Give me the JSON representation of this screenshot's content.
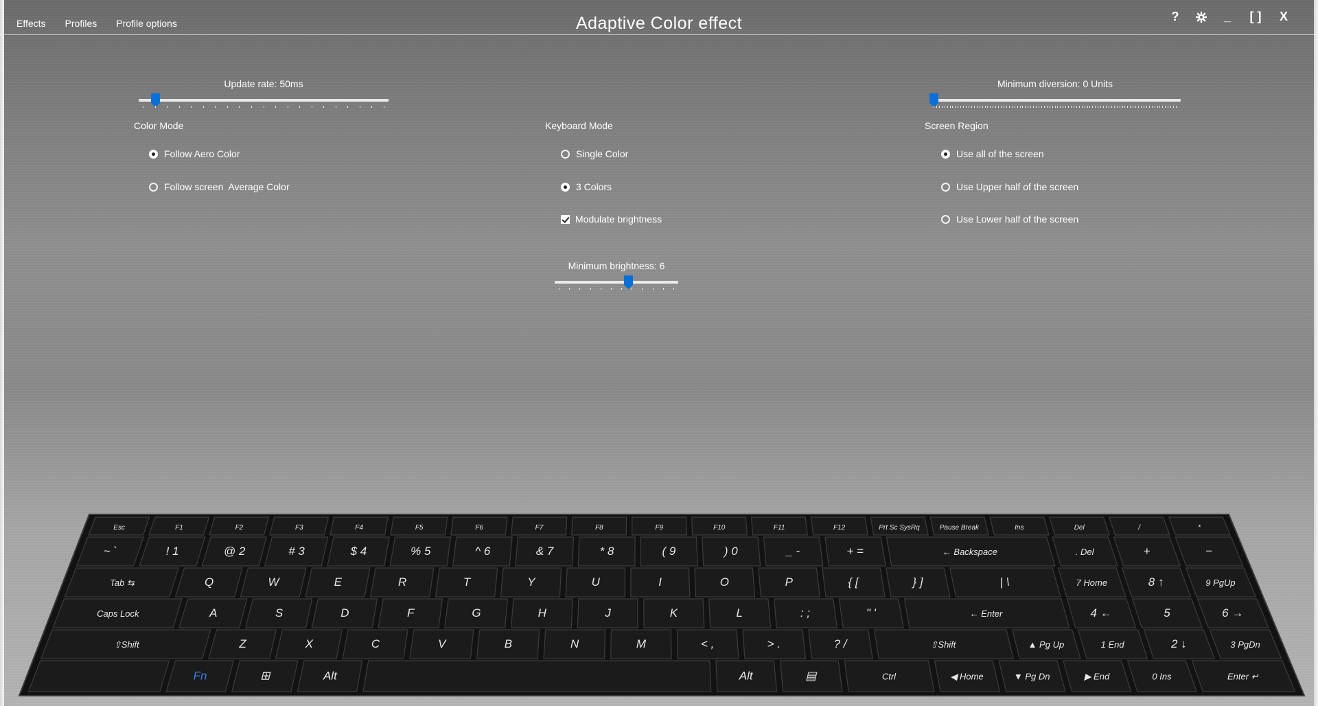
{
  "menu": {
    "items": [
      "Effects",
      "Profiles",
      "Profile options"
    ]
  },
  "window": {
    "title": "Adaptive Color effect",
    "controls": {
      "help": "?",
      "minimize": "_",
      "maximize": "[ ]",
      "close": "X"
    }
  },
  "sliders": {
    "update_rate": {
      "label": "Update rate: 50ms",
      "fraction": 0.05
    },
    "min_diversion": {
      "label": "Minimum diversion: 0 Units",
      "fraction": 0.0
    },
    "min_brightness": {
      "label": "Minimum brightness: 6",
      "fraction": 0.6
    }
  },
  "color_mode": {
    "title": "Color Mode",
    "options": [
      {
        "label": "Follow Aero Color",
        "selected": true
      },
      {
        "label": "Follow screen  Average Color",
        "selected": false
      }
    ]
  },
  "keyboard_mode": {
    "title": "Keyboard Mode",
    "options": [
      {
        "label": "Single Color",
        "selected": false
      },
      {
        "label": "3 Colors",
        "selected": true
      }
    ],
    "modulate": {
      "label": "Modulate brightness",
      "checked": true
    }
  },
  "screen_region": {
    "title": "Screen Region",
    "options": [
      {
        "label": "Use all of the screen",
        "selected": true
      },
      {
        "label": "Use Upper half of the screen",
        "selected": false
      },
      {
        "label": "Use Lower half of the screen",
        "selected": false
      }
    ]
  },
  "keyboard": {
    "rows": [
      [
        {
          "k": "key-esc",
          "t": "Esc"
        },
        {
          "k": "key-f1",
          "t": "F1"
        },
        {
          "k": "key-f2",
          "t": "F2"
        },
        {
          "k": "key-f3",
          "t": "F3"
        },
        {
          "k": "key-f4",
          "t": "F4"
        },
        {
          "k": "key-f5",
          "t": "F5"
        },
        {
          "k": "key-f6",
          "t": "F6"
        },
        {
          "k": "key-f7",
          "t": "F7"
        },
        {
          "k": "key-f8",
          "t": "F8"
        },
        {
          "k": "key-f9",
          "t": "F9"
        },
        {
          "k": "key-f10",
          "t": "F10"
        },
        {
          "k": "key-f11",
          "t": "F11"
        },
        {
          "k": "key-f12",
          "t": "F12"
        },
        {
          "k": "key-prtsc",
          "t": "Prt Sc SysRq"
        },
        {
          "k": "key-pause",
          "t": "Pause Break"
        },
        {
          "k": "key-ins",
          "t": "Ins"
        },
        {
          "k": "key-del",
          "t": "Del"
        },
        {
          "k": "key-numpad-slash",
          "t": "/"
        },
        {
          "k": "key-numpad-star",
          "t": "*"
        }
      ],
      [
        {
          "k": "key-tilde",
          "t": "~ `"
        },
        {
          "k": "key-1",
          "t": "! 1"
        },
        {
          "k": "key-2",
          "t": "@ 2"
        },
        {
          "k": "key-3",
          "t": "# 3"
        },
        {
          "k": "key-4",
          "t": "$ 4"
        },
        {
          "k": "key-5",
          "t": "% 5"
        },
        {
          "k": "key-6",
          "t": "^ 6"
        },
        {
          "k": "key-7",
          "t": "& 7"
        },
        {
          "k": "key-8",
          "t": "* 8"
        },
        {
          "k": "key-9",
          "t": "( 9"
        },
        {
          "k": "key-0",
          "t": ") 0"
        },
        {
          "k": "key-minus",
          "t": "_ -"
        },
        {
          "k": "key-equals",
          "t": "+ ="
        },
        {
          "k": "key-backspace",
          "t": "← Backspace"
        },
        {
          "k": "key-numpad-del",
          "t": ". Del"
        },
        {
          "k": "key-numpad-plus",
          "t": "+"
        },
        {
          "k": "key-numpad-minus",
          "t": "−"
        }
      ],
      [
        {
          "k": "key-tab",
          "t": "Tab ⇆"
        },
        {
          "k": "key-q",
          "t": "Q"
        },
        {
          "k": "key-w",
          "t": "W"
        },
        {
          "k": "key-e",
          "t": "E"
        },
        {
          "k": "key-r",
          "t": "R"
        },
        {
          "k": "key-t",
          "t": "T"
        },
        {
          "k": "key-y",
          "t": "Y"
        },
        {
          "k": "key-u",
          "t": "U"
        },
        {
          "k": "key-i",
          "t": "I"
        },
        {
          "k": "key-o",
          "t": "O"
        },
        {
          "k": "key-p",
          "t": "P"
        },
        {
          "k": "key-lbracket",
          "t": "{ ["
        },
        {
          "k": "key-rbracket",
          "t": "} ]"
        },
        {
          "k": "key-backslash",
          "t": "| \\"
        },
        {
          "k": "key-numpad-7",
          "t": "7 Home"
        },
        {
          "k": "key-numpad-8",
          "t": "8 ↑"
        },
        {
          "k": "key-numpad-9",
          "t": "9 PgUp"
        }
      ],
      [
        {
          "k": "key-capslock",
          "t": "Caps Lock"
        },
        {
          "k": "key-a",
          "t": "A"
        },
        {
          "k": "key-s",
          "t": "S"
        },
        {
          "k": "key-d",
          "t": "D"
        },
        {
          "k": "key-f",
          "t": "F"
        },
        {
          "k": "key-g",
          "t": "G"
        },
        {
          "k": "key-h",
          "t": "H"
        },
        {
          "k": "key-j",
          "t": "J"
        },
        {
          "k": "key-k",
          "t": "K"
        },
        {
          "k": "key-l",
          "t": "L"
        },
        {
          "k": "key-semicolon",
          "t": ": ;"
        },
        {
          "k": "key-quote",
          "t": "\" '"
        },
        {
          "k": "key-enter",
          "t": "← Enter"
        },
        {
          "k": "key-numpad-4",
          "t": "4 ←"
        },
        {
          "k": "key-numpad-5",
          "t": "5"
        },
        {
          "k": "key-numpad-6",
          "t": "6 →"
        }
      ],
      [
        {
          "k": "key-lshift",
          "t": "⇧Shift"
        },
        {
          "k": "key-z",
          "t": "Z"
        },
        {
          "k": "key-x",
          "t": "X"
        },
        {
          "k": "key-c",
          "t": "C"
        },
        {
          "k": "key-v",
          "t": "V"
        },
        {
          "k": "key-b",
          "t": "B"
        },
        {
          "k": "key-n",
          "t": "N"
        },
        {
          "k": "key-m",
          "t": "M"
        },
        {
          "k": "key-comma",
          "t": "< ,"
        },
        {
          "k": "key-period",
          "t": "> ."
        },
        {
          "k": "key-slash",
          "t": "? /"
        },
        {
          "k": "key-rshift",
          "t": "⇧Shift"
        },
        {
          "k": "key-up",
          "t": "▲ Pg Up"
        },
        {
          "k": "key-numpad-1",
          "t": "1 End"
        },
        {
          "k": "key-numpad-2",
          "t": "2 ↓"
        },
        {
          "k": "key-numpad-3",
          "t": "3 PgDn"
        }
      ],
      [
        {
          "k": "key-lctrl",
          "t": ""
        },
        {
          "k": "key-fn",
          "t": "Fn"
        },
        {
          "k": "key-win",
          "t": "⊞"
        },
        {
          "k": "key-lalt",
          "t": "Alt"
        },
        {
          "k": "key-space",
          "t": ""
        },
        {
          "k": "key-ralt",
          "t": "Alt"
        },
        {
          "k": "key-menu",
          "t": "▤"
        },
        {
          "k": "key-rctrl",
          "t": "Ctrl"
        },
        {
          "k": "key-left",
          "t": "◀ Home"
        },
        {
          "k": "key-down",
          "t": "▼ Pg Dn"
        },
        {
          "k": "key-right",
          "t": "▶ End"
        },
        {
          "k": "key-numpad-0",
          "t": "0 Ins"
        },
        {
          "k": "key-numpad-enter",
          "t": "Enter ↵"
        }
      ]
    ]
  },
  "colors": {
    "accent": "#0a6fd6",
    "fn_blue": "#3b7fe6",
    "key_bg": "#1b1b1b",
    "keyboard_body": "#121212"
  }
}
